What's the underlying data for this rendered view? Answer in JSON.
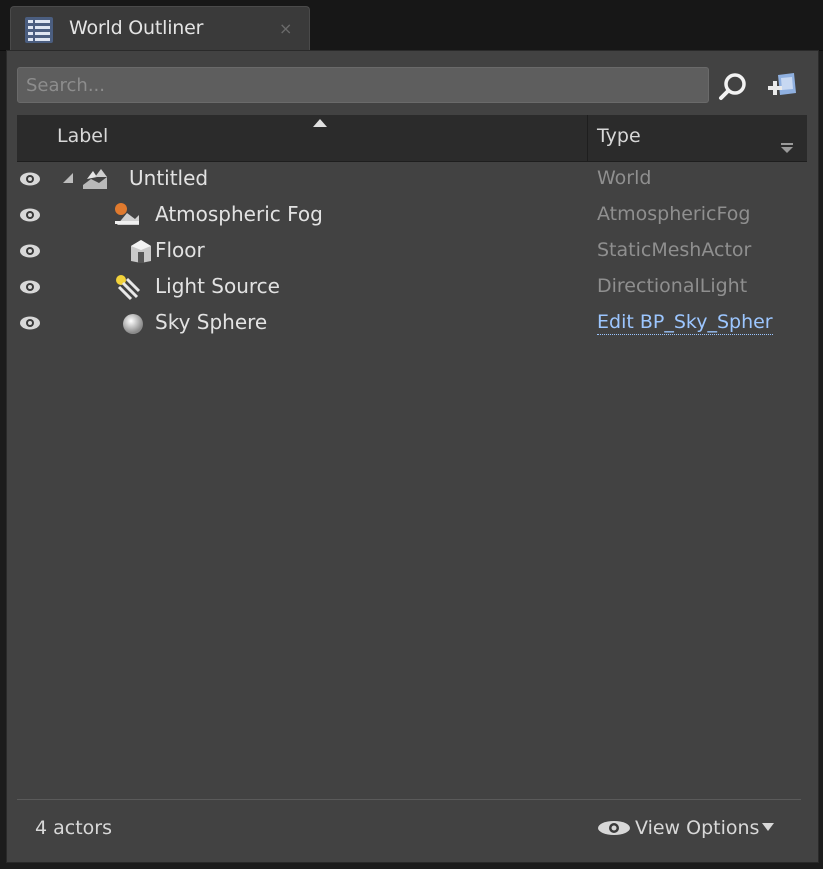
{
  "tab": {
    "title": "World Outliner",
    "close_glyph": "×",
    "icon": "list-icon"
  },
  "search": {
    "placeholder": "Search...",
    "value": ""
  },
  "columns": {
    "label": "Label",
    "type": "Type",
    "sorted_by": "Label"
  },
  "rows": [
    {
      "label": "Untitled",
      "type": "World",
      "icon": "world-icon",
      "depth": 0,
      "expanded": true,
      "visible": true
    },
    {
      "label": "Atmospheric Fog",
      "type": "AtmosphericFog",
      "icon": "atmospheric-fog-icon",
      "depth": 1,
      "visible": true
    },
    {
      "label": "Floor",
      "type": "StaticMeshActor",
      "icon": "static-mesh-icon",
      "depth": 1,
      "visible": true
    },
    {
      "label": "Light Source",
      "type": "DirectionalLight",
      "icon": "directional-light-icon",
      "depth": 1,
      "visible": true
    },
    {
      "label": "Sky Sphere",
      "type": "Edit BP_Sky_Spher",
      "icon": "sky-sphere-icon",
      "depth": 1,
      "visible": true,
      "type_is_link": true
    }
  ],
  "footer": {
    "actor_count": "4 actors",
    "view_options": "View Options"
  },
  "colors": {
    "panel_bg": "#424242",
    "link": "#9cc6ff",
    "type_text": "#8f8f8f"
  }
}
